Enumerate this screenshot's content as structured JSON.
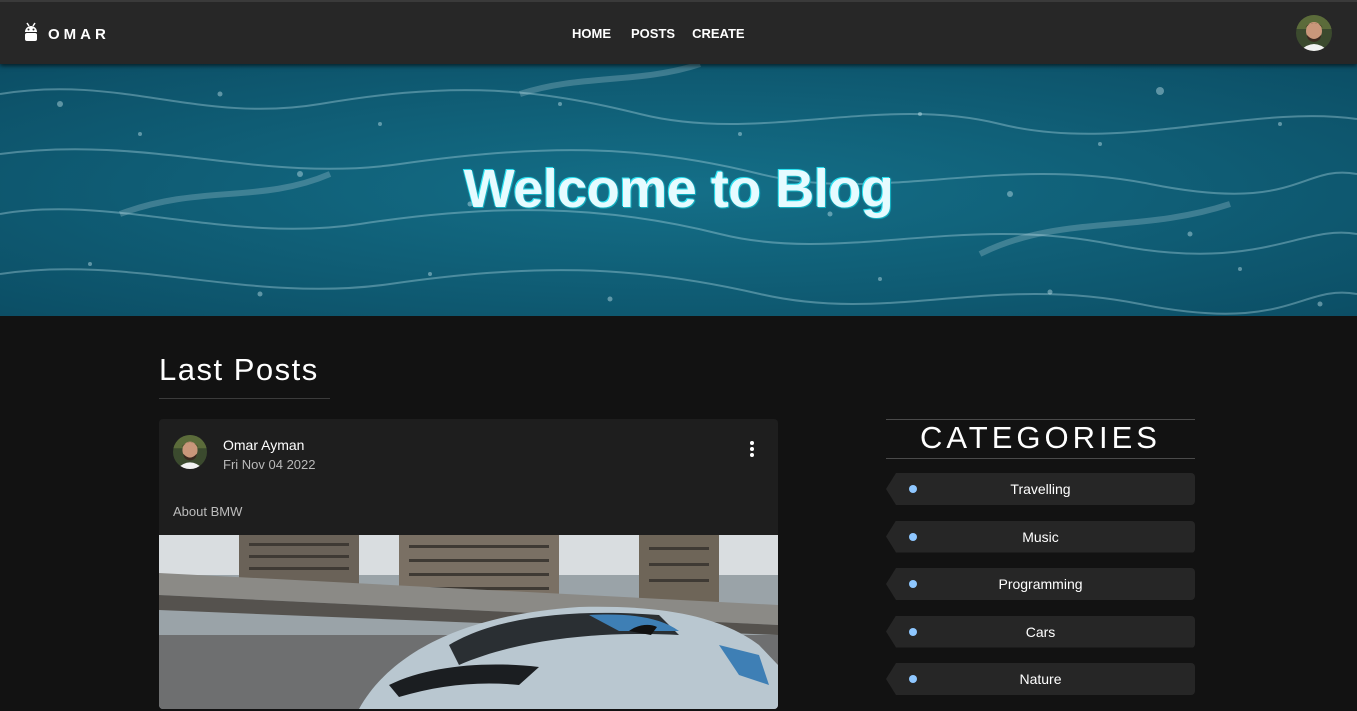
{
  "navbar": {
    "brand": "OMAR",
    "brand_icon": "android-icon",
    "links": [
      "HOME",
      "POSTS",
      "CREATE"
    ]
  },
  "hero": {
    "title": "Welcome to Blog"
  },
  "main": {
    "section_title": "Last Posts",
    "post": {
      "author": "Omar Ayman",
      "date": "Fri Nov 04 2022",
      "description": "About BMW",
      "menu_icon": "more-vertical-icon"
    }
  },
  "sidebar": {
    "title": "CATEGORIES",
    "categories": [
      "Travelling",
      "Music",
      "Programming",
      "Cars",
      "Nature"
    ]
  },
  "colors": {
    "navbar_bg": "#272727",
    "page_bg": "#121212",
    "card_bg": "#1e1e1e",
    "category_dot": "#8ec7ff",
    "hero_water": "#0d5a73"
  }
}
